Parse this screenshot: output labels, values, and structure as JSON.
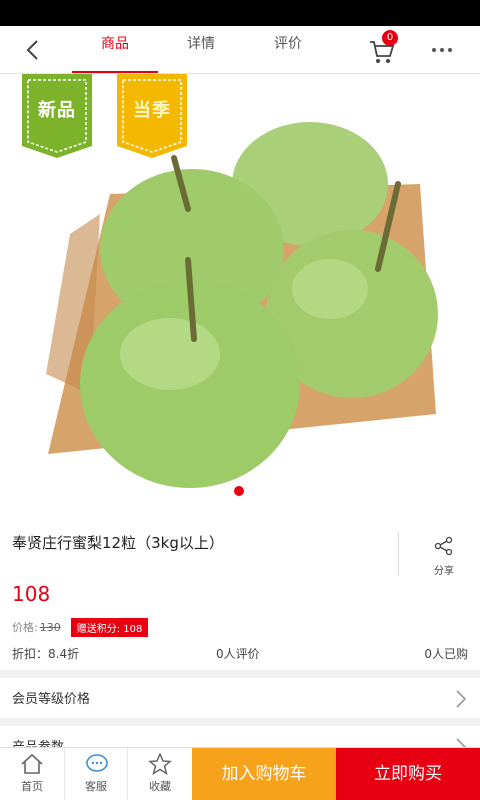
{
  "header": {
    "tabs": [
      {
        "label": "商品",
        "active": true
      },
      {
        "label": "详情",
        "active": false
      },
      {
        "label": "评价",
        "active": false
      }
    ],
    "cart_count": "0",
    "icons": {
      "back": "back-arrow-icon",
      "cart": "cart-icon",
      "more": "more-dots-icon"
    }
  },
  "hero": {
    "tags": [
      "新品",
      "当季"
    ],
    "accent_color": "#e60012",
    "tag_colors": {
      "new": "#7db32a",
      "season": "#f5b800"
    }
  },
  "product": {
    "title": "奉贤庄行蜜梨12粒（3kg以上）",
    "share_label": "分享",
    "price": "108",
    "original_price_label": "价格:",
    "original_price": "130",
    "points_badge": "赠送积分: 108",
    "discount": "折扣：8.4折",
    "reviews": "0人评价",
    "sold": "0人已购"
  },
  "sections": {
    "member_price": "会员等级价格",
    "params": "产品参数"
  },
  "bottom_bar": {
    "home": "首页",
    "service": "客服",
    "favorite": "收藏",
    "add_to_cart": "加入购物车",
    "buy_now": "立即购买",
    "colors": {
      "add_to_cart": "#f7a21b",
      "buy_now": "#e60012"
    }
  }
}
